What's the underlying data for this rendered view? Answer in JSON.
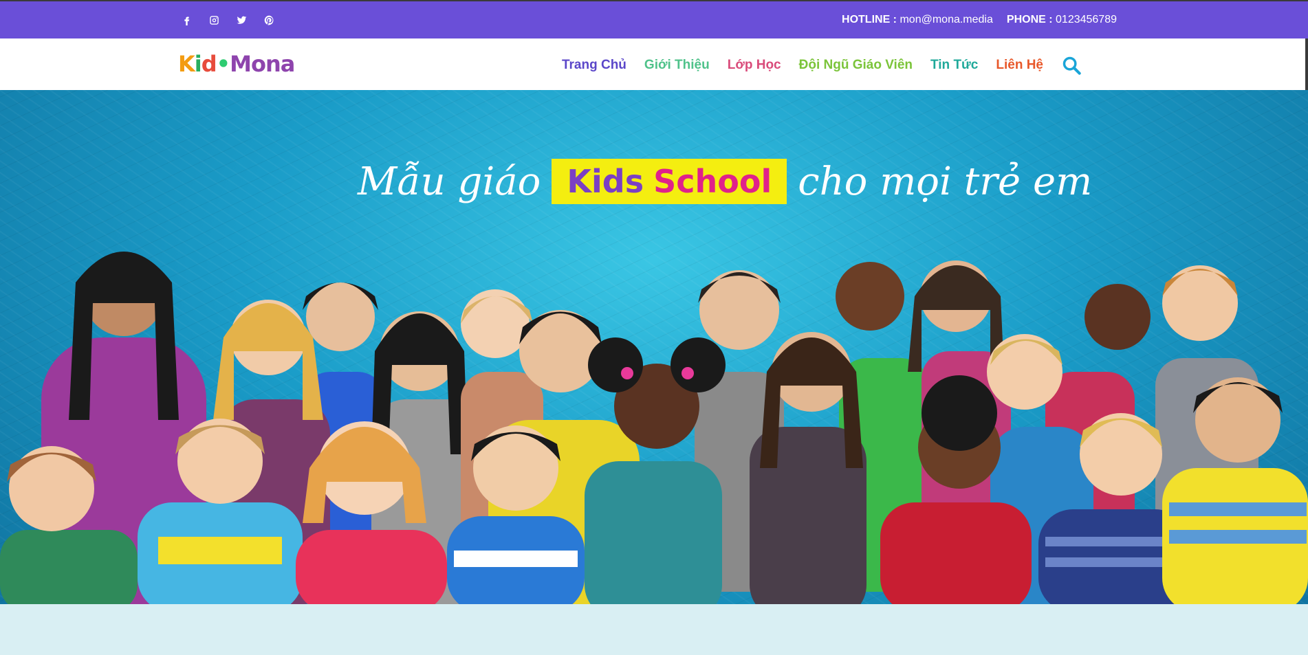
{
  "topbar": {
    "social_icons": [
      "facebook-icon",
      "instagram-icon",
      "twitter-icon",
      "pinterest-icon"
    ],
    "hotline_label": "HOTLINE :",
    "hotline_value": "mon@mona.media",
    "phone_label": "PHONE :",
    "phone_value": "0123456789",
    "background": "#6a4fd8"
  },
  "header": {
    "logo": {
      "k": "K",
      "i": "i",
      "d": "d",
      "dot": "•",
      "m": "Mona"
    },
    "nav": [
      {
        "label": "Trang Chủ",
        "color": "#5b47c9"
      },
      {
        "label": "Giới Thiệu",
        "color": "#4fc28a"
      },
      {
        "label": "Lớp Học",
        "color": "#d94b7a"
      },
      {
        "label": "Đội Ngũ Giáo Viên",
        "color": "#7bc43a"
      },
      {
        "label": "Tin Tức",
        "color": "#1fa99a"
      },
      {
        "label": "Liên Hệ",
        "color": "#e8582a"
      }
    ],
    "search_icon": "search-icon"
  },
  "hero": {
    "slogan_left": "Mẫu giáo",
    "badge_kids": "Kids",
    "badge_school": "School",
    "slogan_right": "cho mọi trẻ em"
  }
}
